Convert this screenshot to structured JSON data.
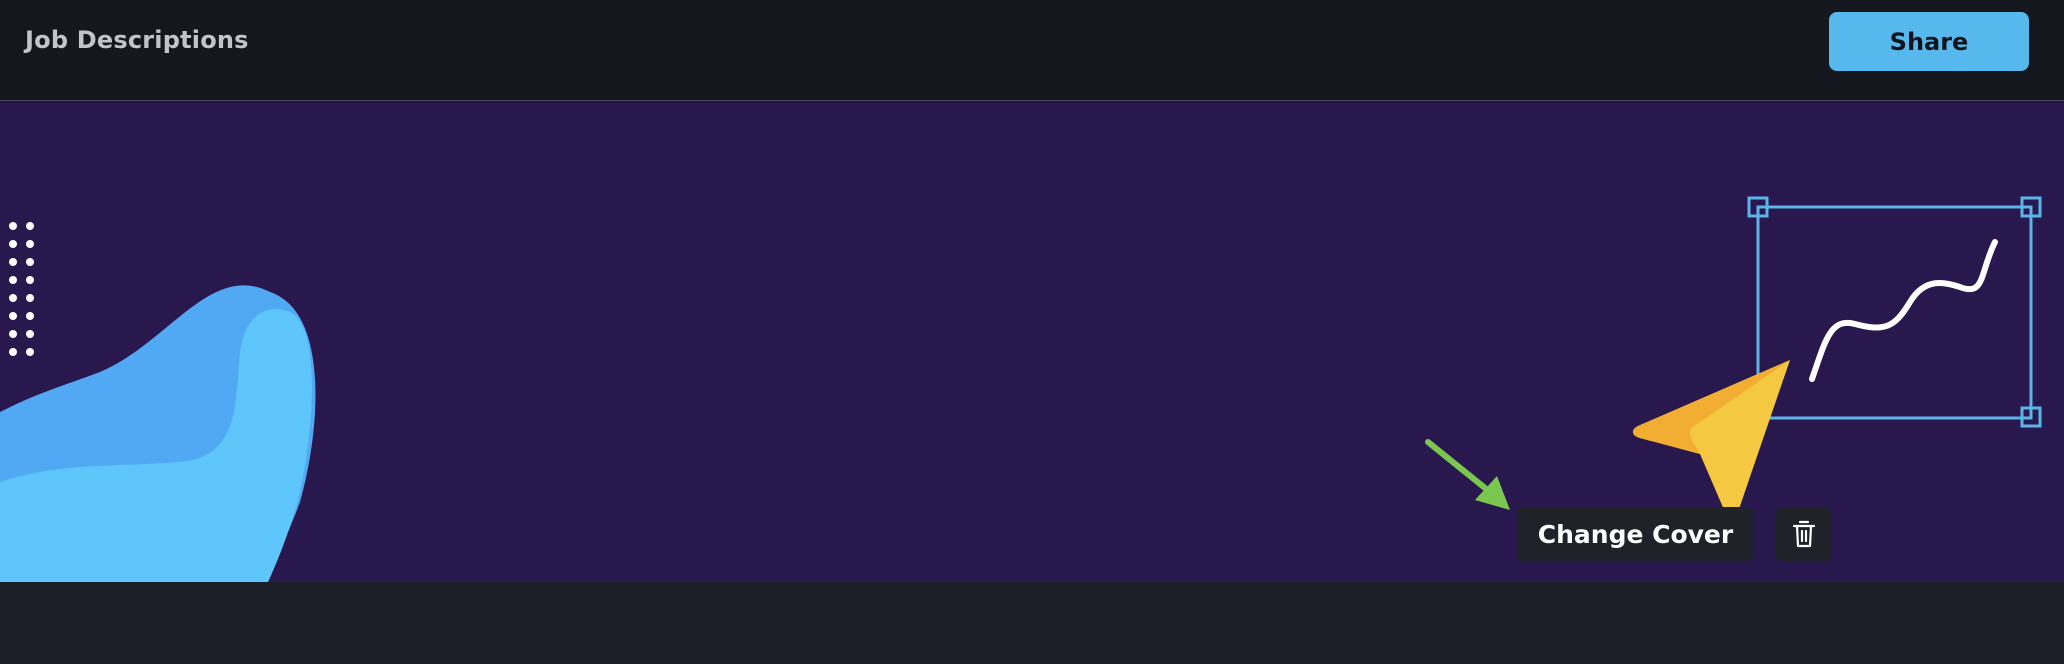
{
  "header": {
    "title": "Job Descriptions",
    "share_label": "Share"
  },
  "cover": {
    "change_cover_label": "Change Cover",
    "delete_icon": "trash-icon",
    "background_color": "#29184d",
    "blob_colors": [
      "#52a9f3",
      "#5fc6fb"
    ],
    "pointer_icon": "cursor-arrow-icon",
    "selection_icon": "squiggle-line-icon",
    "hint_arrow_icon": "green-arrow-icon"
  },
  "colors": {
    "accent": "#56b8ec",
    "selection": "#59b5ea",
    "pointer": "#f5c842",
    "hint_arrow": "#7ac74f"
  }
}
